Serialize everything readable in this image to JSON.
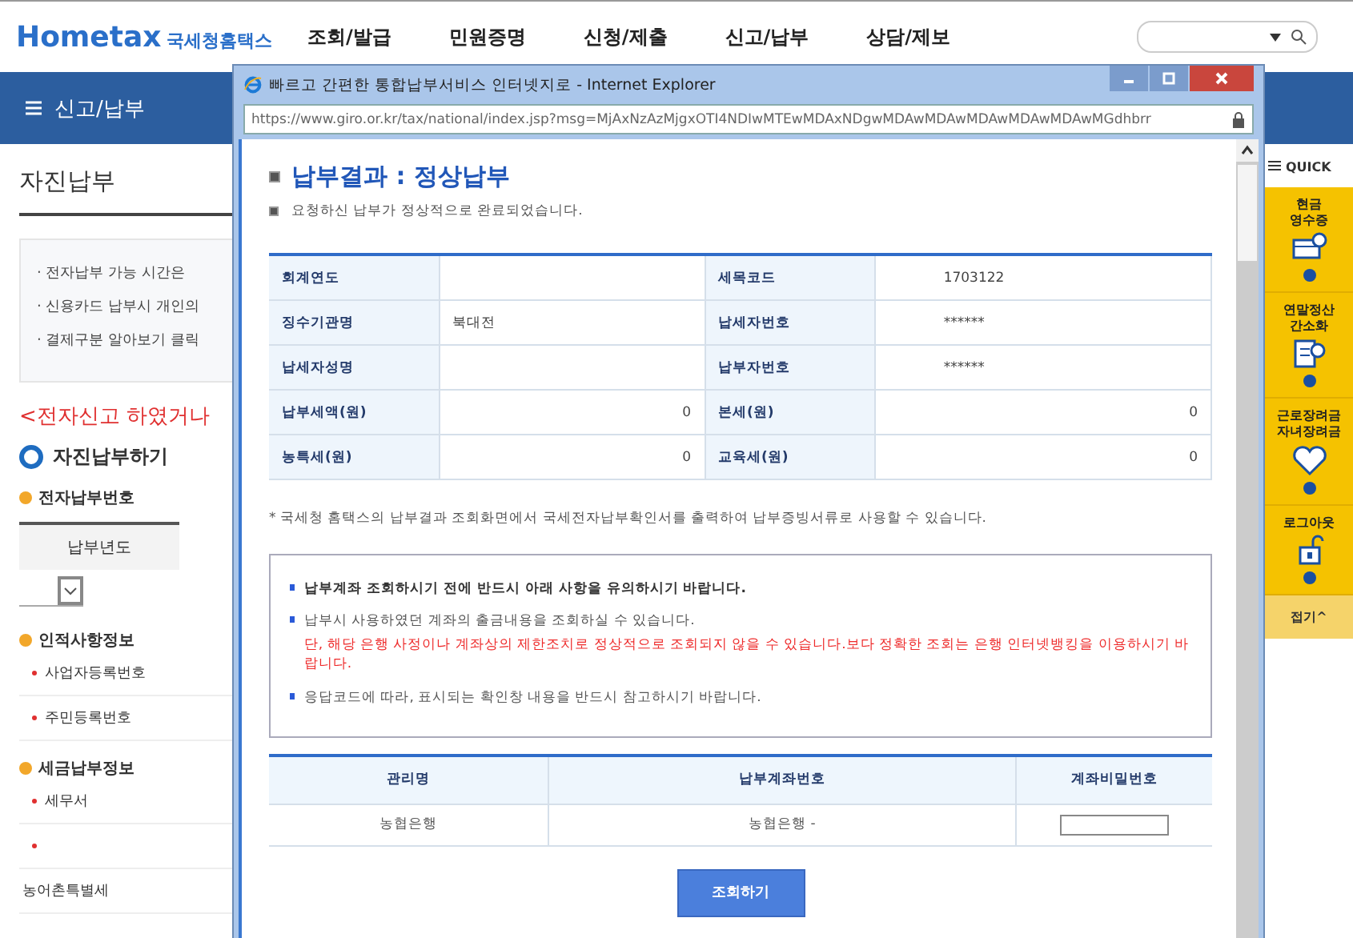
{
  "site_header": {
    "logo_text": "Hometax",
    "logo_subtitle": "국세청홈택스",
    "nav": [
      "조회/발급",
      "민원증명",
      "신청/제출",
      "신고/납부",
      "상담/제보"
    ]
  },
  "menu_bar": {
    "title": "신고/납부"
  },
  "page": {
    "title": "자진납부",
    "notices": [
      "· 전자납부 가능 시간은",
      "· 신용카드 납부시 개인의",
      "· 결제구분 알아보기 클릭"
    ],
    "warning": "<전자신고 하였거나",
    "section_title": "자진납부하기",
    "groups": [
      {
        "title": "전자납부번호",
        "kind": "table",
        "column": "납부년도"
      },
      {
        "title": "인적사항정보",
        "kind": "fields",
        "fields": [
          {
            "label": "사업자등록번호",
            "required": true
          },
          {
            "label": "주민등록번호",
            "required": true
          }
        ]
      },
      {
        "title": "세금납부정보",
        "kind": "fields",
        "fields": [
          {
            "label": "세무서",
            "required": true
          },
          {
            "required": true
          },
          {
            "label": "농어촌특별세",
            "required": false
          }
        ]
      }
    ]
  },
  "popup": {
    "title": "빠르고 간편한 통합납부서비스 인터넷지로 - Internet Explorer",
    "url": "https://www.giro.or.kr/tax/national/index.jsp?msg=MjAxNzAzMjgxOTI4NDIwMTEwMDAxNDgwMDAwMDAwMDAwMDAwMDAwMGdhbrr",
    "heading": "납부결과 : 정상납부",
    "subtext": "요청하신 납부가 정상적으로 완료되었습니다.",
    "result_rows": [
      {
        "kind": "text",
        "cells": [
          {
            "label": "회계연도"
          },
          {
            "label": "세목코드",
            "value": "1703122"
          }
        ]
      },
      {
        "kind": "text",
        "cells": [
          {
            "label": "징수기관명",
            "value": "북대전"
          },
          {
            "label": "납세자번호",
            "value": "******"
          }
        ]
      },
      {
        "kind": "text",
        "cells": [
          {
            "label": "납세자성명"
          },
          {
            "label": "납부자번호",
            "value": "******"
          }
        ]
      },
      {
        "kind": "amount",
        "cells": [
          {
            "label": "납부세액(원)",
            "value": "0"
          },
          {
            "label": "본세(원)",
            "value": "0"
          }
        ]
      },
      {
        "kind": "amount",
        "cells": [
          {
            "label": "농특세(원)",
            "value": "0"
          },
          {
            "label": "교육세(원)",
            "value": "0"
          }
        ]
      }
    ],
    "footnote": "* 국세청 홈택스의 납부결과 조회화면에서 국세전자납부확인서를 출력하여 납부증빙서류로 사용할 수 있습니다.",
    "notices": [
      {
        "kind": "bold",
        "text": "납부계좌 조회하시기 전에 반드시 아래 사항을 유의하시기 바랍니다."
      },
      {
        "kind": "plain",
        "text": "납부시 사용하였던 계좌의 출금내용을 조회하실 수 있습니다.",
        "warning": "단, 해당 은행 사정이나 계좌상의 제한조치로 정상적으로 조회되지 않을 수 있습니다.보다 정확한 조회는 은행 인터넷뱅킹을 이용하시기 바랍니다."
      },
      {
        "kind": "plain",
        "text": "응답코드에 따라, 표시되는 확인창 내용을 반드시 참고하시기 바랍니다."
      }
    ],
    "account_table": {
      "columns": [
        "관리명",
        "납부계좌번호",
        "계좌비밀번호"
      ],
      "rows": [
        {
          "bank": "농협은행",
          "account": "농협은행 -"
        }
      ]
    },
    "button": "조회하기"
  },
  "quick": {
    "title": "QUICK",
    "items": [
      {
        "label": "현금\n영수증",
        "kind": "receipt"
      },
      {
        "label": "연말정산\n간소화",
        "kind": "document"
      },
      {
        "label": "근로장려금\n자녀장려금",
        "kind": "heart"
      },
      {
        "label": "로그아웃",
        "kind": "lock"
      }
    ],
    "collapse": "접기^"
  }
}
